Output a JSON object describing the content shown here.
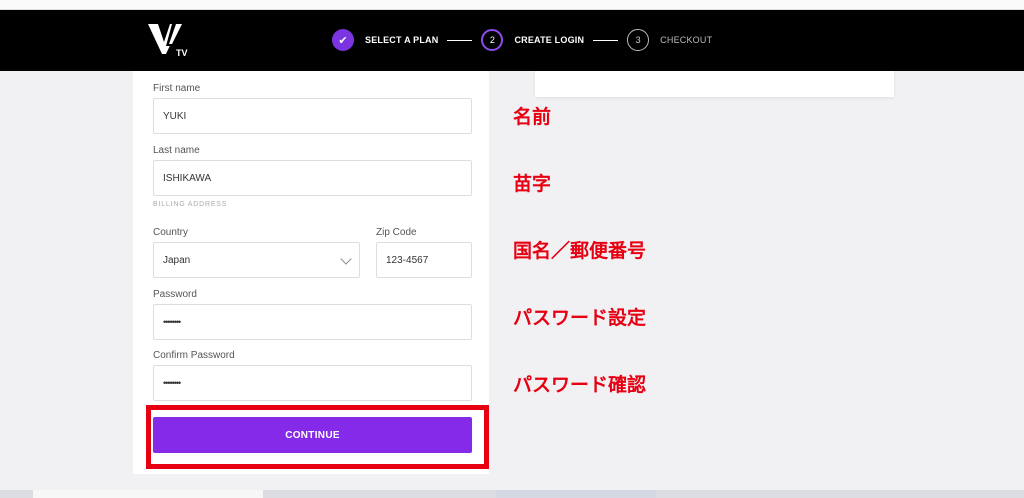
{
  "header": {
    "logo_text": "TV",
    "steps": [
      {
        "number": "✔",
        "label": "SELECT A PLAN",
        "state": "done"
      },
      {
        "number": "2",
        "label": "CREATE LOGIN",
        "state": "active"
      },
      {
        "number": "3",
        "label": "CHECKOUT",
        "state": "pending"
      }
    ]
  },
  "form": {
    "first_name": {
      "label": "First name",
      "value": "YUKI"
    },
    "last_name": {
      "label": "Last name",
      "value": "ISHIKAWA"
    },
    "billing_section": "BILLING ADDRESS",
    "country": {
      "label": "Country",
      "value": "Japan"
    },
    "zip": {
      "label": "Zip Code",
      "value": "123-4567"
    },
    "password": {
      "label": "Password",
      "value": "••••••••"
    },
    "confirm_password": {
      "label": "Confirm Password",
      "value": "••••••••"
    },
    "continue_label": "CONTINUE"
  },
  "annotations": {
    "first_name": "名前",
    "last_name": "苗字",
    "country_zip": "国名／郵便番号",
    "password": "パスワード設定",
    "confirm_password": "パスワード確認"
  },
  "colors": {
    "accent": "#842ae8",
    "annotation_red": "#e60012",
    "header_bg": "#000000"
  }
}
